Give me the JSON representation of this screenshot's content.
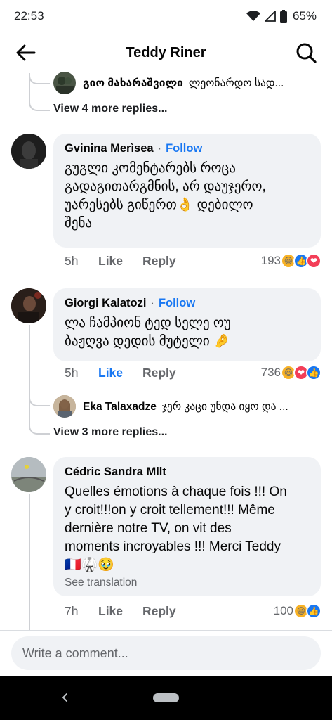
{
  "status_bar": {
    "time": "22:53",
    "battery": "65%"
  },
  "header": {
    "title": "Teddy Riner"
  },
  "thread1": {
    "reply": {
      "author": "გიო მახარაშვილი",
      "text": "ლეონარდო სად..."
    },
    "view_more": "View 4 more replies..."
  },
  "comments": [
    {
      "author": "Gvinina Merìsea",
      "follow": "Follow",
      "separator": "·",
      "lines": [
        "გუგლი კომენტარებს როცა",
        "გადაგითარგმნის, არ დაუჯერო,",
        "უარესებს გიწერთ👌 დებილო",
        "შენა"
      ],
      "time": "5h",
      "like": "Like",
      "reply": "Reply",
      "reaction_count": "193",
      "reactions": [
        "😆",
        "👍",
        "❤"
      ]
    },
    {
      "author": "Giorgi Kalatozi",
      "follow": "Follow",
      "separator": "·",
      "lines": [
        "ლა ჩამპიონ ტედ სელე ოუ",
        "ბაჟღვა დედის მუტელი 🤌"
      ],
      "time": "5h",
      "like": "Like",
      "reply": "Reply",
      "reaction_count": "736",
      "reactions": [
        "😆",
        "❤",
        "👍"
      ]
    },
    {
      "author": "Cédric Sandra Mllt",
      "lines": [
        "Quelles émotions à chaque fois !!! On",
        "y croit!!!on y croit tellement!!! Même",
        "dernière notre TV, on vit des",
        "moments incroyables !!! Merci Teddy",
        "🇫🇷🥋🥹"
      ],
      "see_translation": "See translation",
      "time": "7h",
      "like": "Like",
      "reply": "Reply",
      "reaction_count": "100",
      "reactions": [
        "😆",
        "👍"
      ]
    }
  ],
  "thread2": {
    "reply": {
      "author": "Eka Talaxadze",
      "text": "ჯერ კაცი უნდა იყო და ..."
    },
    "view_more": "View 3 more replies..."
  },
  "composer": {
    "placeholder": "Write a comment..."
  },
  "colors": {
    "accent": "#1877f2",
    "bubble": "#f0f2f5",
    "muted": "#65676b",
    "thread": "#ced0d4"
  }
}
